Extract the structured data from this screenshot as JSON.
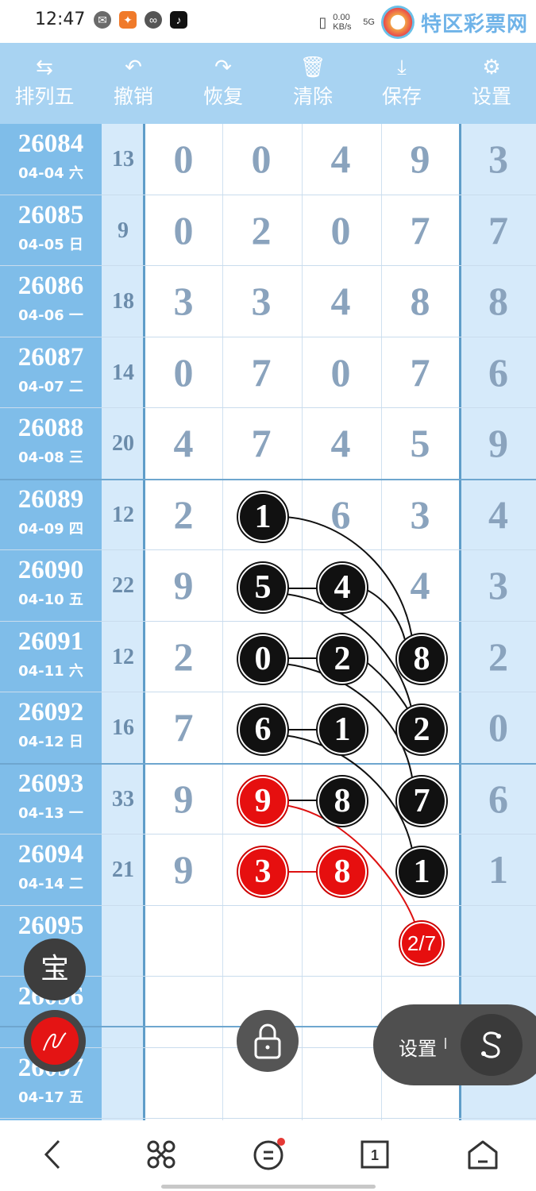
{
  "status_bar": {
    "time": "12:47",
    "network_speed": "0.00 KB/s",
    "signal": "5G",
    "brand": "特区彩票网"
  },
  "toolbar": {
    "items": [
      {
        "label": "排列五",
        "icon": "swap-icon"
      },
      {
        "label": "撤销",
        "icon": "undo-icon"
      },
      {
        "label": "恢复",
        "icon": "redo-icon"
      },
      {
        "label": "清除",
        "icon": "trash-icon"
      },
      {
        "label": "保存",
        "icon": "download-icon"
      },
      {
        "label": "设置",
        "icon": "gear-icon"
      }
    ]
  },
  "rows": [
    {
      "issue": "26084",
      "date": "04-04 六",
      "sum": "13",
      "digits": [
        "0",
        "0",
        "4",
        "9",
        "3"
      ]
    },
    {
      "issue": "26085",
      "date": "04-05 日",
      "sum": "9",
      "digits": [
        "0",
        "2",
        "0",
        "7",
        "7"
      ]
    },
    {
      "issue": "26086",
      "date": "04-06 一",
      "sum": "18",
      "digits": [
        "3",
        "3",
        "4",
        "8",
        "8"
      ]
    },
    {
      "issue": "26087",
      "date": "04-07 二",
      "sum": "14",
      "digits": [
        "0",
        "7",
        "0",
        "7",
        "6"
      ]
    },
    {
      "issue": "26088",
      "date": "04-08 三",
      "sum": "20",
      "digits": [
        "4",
        "7",
        "4",
        "5",
        "9"
      ]
    },
    {
      "issue": "26089",
      "date": "04-09 四",
      "sum": "12",
      "digits": [
        "2",
        "",
        "6",
        "3",
        "4"
      ]
    },
    {
      "issue": "26090",
      "date": "04-10 五",
      "sum": "22",
      "digits": [
        "9",
        "",
        "",
        "4",
        "3"
      ]
    },
    {
      "issue": "26091",
      "date": "04-11 六",
      "sum": "12",
      "digits": [
        "2",
        "",
        "",
        "",
        "2"
      ]
    },
    {
      "issue": "26092",
      "date": "04-12 日",
      "sum": "16",
      "digits": [
        "7",
        "",
        "",
        "",
        "0"
      ]
    },
    {
      "issue": "26093",
      "date": "04-13 一",
      "sum": "33",
      "digits": [
        "9",
        "",
        "",
        "",
        "6"
      ]
    },
    {
      "issue": "26094",
      "date": "04-14 二",
      "sum": "21",
      "digits": [
        "9",
        "",
        "",
        "",
        "1"
      ]
    },
    {
      "issue": "26095",
      "date": "",
      "sum": "",
      "digits": [
        "",
        "",
        "",
        "",
        ""
      ]
    },
    {
      "issue": "26096",
      "date": "",
      "sum": "",
      "digits": [
        "",
        "",
        "",
        "",
        ""
      ]
    },
    {
      "issue": "26097",
      "date": "04-17 五",
      "sum": "",
      "digits": [
        "",
        "",
        "",
        "",
        ""
      ]
    }
  ],
  "balls": [
    {
      "label": "1",
      "color": "black"
    },
    {
      "label": "5",
      "color": "black"
    },
    {
      "label": "4",
      "color": "black"
    },
    {
      "label": "8",
      "color": "black"
    },
    {
      "label": "0",
      "color": "black"
    },
    {
      "label": "2",
      "color": "black"
    },
    {
      "label": "2",
      "color": "black"
    },
    {
      "label": "6",
      "color": "black"
    },
    {
      "label": "1",
      "color": "black"
    },
    {
      "label": "7",
      "color": "black"
    },
    {
      "label": "9",
      "color": "red"
    },
    {
      "label": "8",
      "color": "black"
    },
    {
      "label": "1",
      "color": "black"
    },
    {
      "label": "3",
      "color": "red"
    },
    {
      "label": "8",
      "color": "red"
    },
    {
      "label": "2/7",
      "color": "red"
    }
  ],
  "floating": {
    "bao_label": "宝",
    "settings_label": "设置"
  },
  "colors": {
    "toolbar": "#a8d3f2",
    "issue_col": "#7fbde9",
    "light_col": "#d6eafa",
    "ball_black": "#111111",
    "ball_red": "#e60f0f"
  }
}
